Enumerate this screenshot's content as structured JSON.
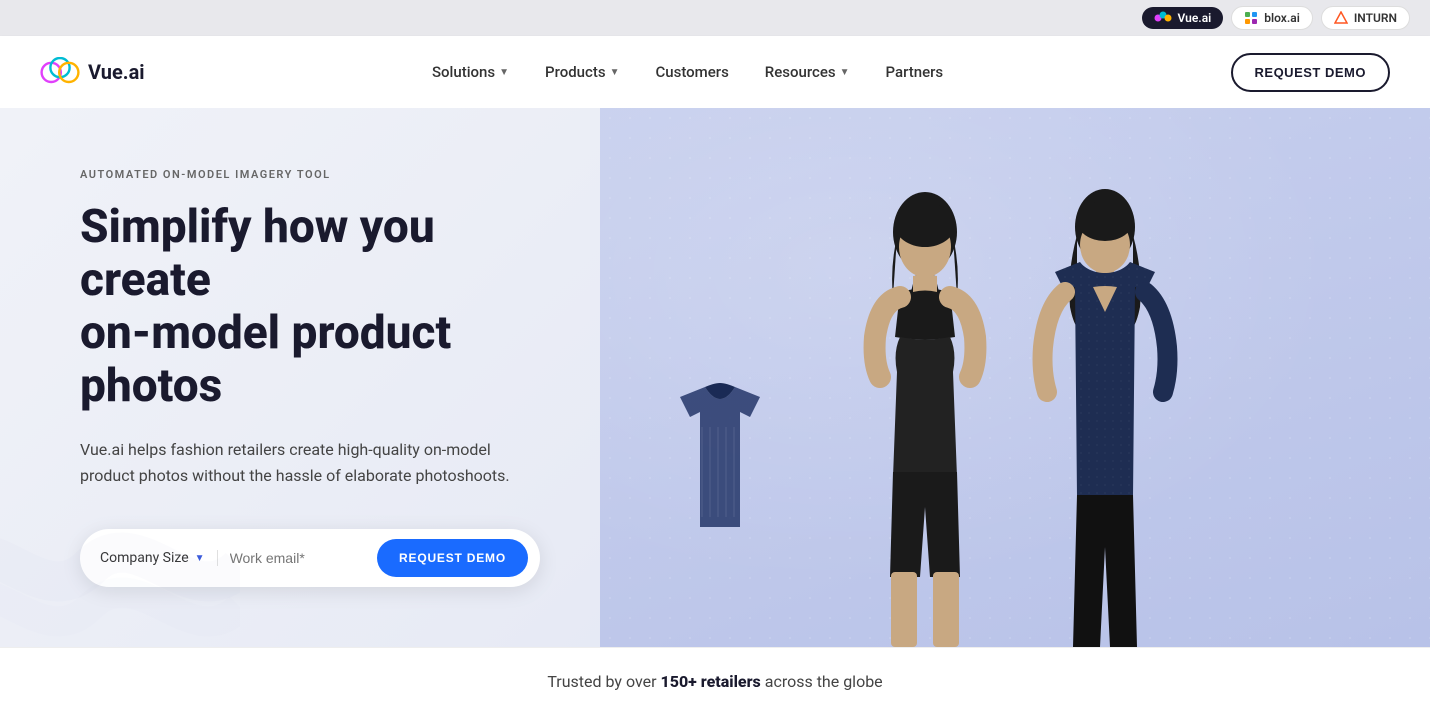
{
  "topbar": {
    "badges": [
      {
        "id": "vue-ai",
        "label": "Vue.ai",
        "active": true
      },
      {
        "id": "blox-ai",
        "label": "blox.ai",
        "active": false
      },
      {
        "id": "inturn",
        "label": "INTURN",
        "active": false
      }
    ]
  },
  "nav": {
    "logo_text": "Vue.ai",
    "links": [
      {
        "label": "Solutions",
        "has_dropdown": true
      },
      {
        "label": "Products",
        "has_dropdown": true
      },
      {
        "label": "Customers",
        "has_dropdown": false
      },
      {
        "label": "Resources",
        "has_dropdown": true
      },
      {
        "label": "Partners",
        "has_dropdown": false
      }
    ],
    "cta_label": "REQUEST DEMO"
  },
  "hero": {
    "eyebrow": "AUTOMATED ON-MODEL IMAGERY TOOL",
    "title_line1": "Simplify how you create",
    "title_line2": "on-model product photos",
    "subtitle": "Vue.ai helps fashion retailers create high-quality on-model product photos without the hassle of elaborate photoshoots.",
    "form": {
      "company_size_label": "Company Size",
      "email_placeholder": "Work email*",
      "cta_label": "REQUEST DEMO"
    }
  },
  "trusted_bar": {
    "prefix": "Trusted by over ",
    "highlight": "150+ retailers",
    "suffix": " across the globe"
  }
}
